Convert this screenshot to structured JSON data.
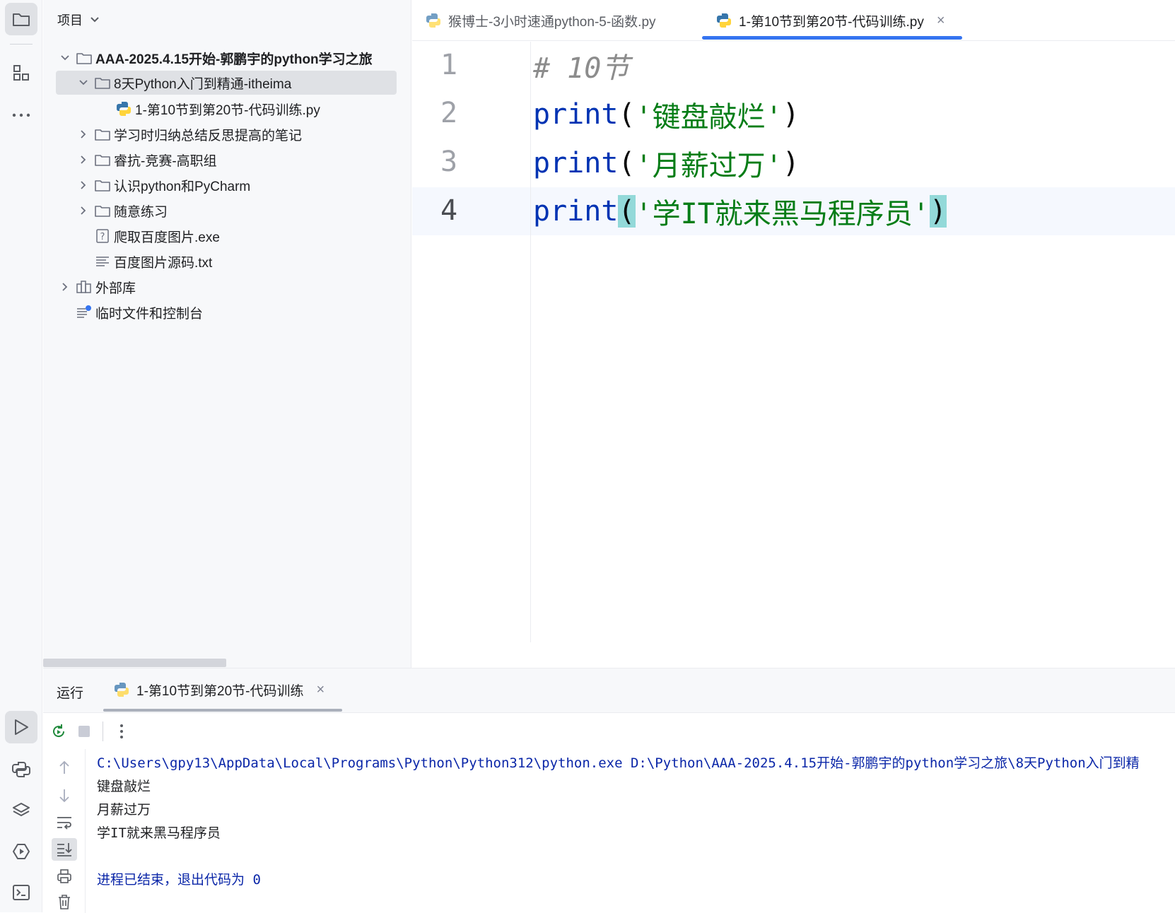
{
  "project_panel": {
    "title": "项目",
    "tree": [
      {
        "label": "AAA-2025.4.15开始-郭鹏宇的python学习之旅",
        "type": "folder",
        "depth": 0,
        "expanded": true,
        "bold": true
      },
      {
        "label": "8天Python入门到精通-itheima",
        "type": "folder",
        "depth": 1,
        "expanded": true,
        "selected": true
      },
      {
        "label": "1-第10节到第20节-代码训练.py",
        "type": "python-file",
        "depth": 2
      },
      {
        "label": "学习时归纳总结反思提高的笔记",
        "type": "folder",
        "depth": 1,
        "expanded": false
      },
      {
        "label": "睿抗-竞赛-高职组",
        "type": "folder",
        "depth": 1,
        "expanded": false
      },
      {
        "label": "认识python和PyCharm",
        "type": "folder",
        "depth": 1,
        "expanded": false
      },
      {
        "label": "随意练习",
        "type": "folder",
        "depth": 1,
        "expanded": false
      },
      {
        "label": "爬取百度图片.exe",
        "type": "unknown-file",
        "depth": 1
      },
      {
        "label": "百度图片源码.txt",
        "type": "text-file",
        "depth": 1
      },
      {
        "label": "外部库",
        "type": "library",
        "depth": 0,
        "expanded": false
      },
      {
        "label": "临时文件和控制台",
        "type": "scratches",
        "depth": 0
      }
    ]
  },
  "editor_tabs": [
    {
      "label": "猴博士-3小时速通python-5-函数.py",
      "active": false
    },
    {
      "label": "1-第10节到第20节-代码训练.py",
      "active": true,
      "close": "×"
    }
  ],
  "editor": {
    "line_numbers": [
      "1",
      "2",
      "3",
      "4"
    ],
    "lines": [
      {
        "comment": "# 10节"
      },
      {
        "func": "print",
        "open": "(",
        "string": "'键盘敲烂'",
        "close": ")"
      },
      {
        "func": "print",
        "open": "(",
        "string": "'月薪过万'",
        "close": ")"
      },
      {
        "func": "print",
        "open": "(",
        "string": "'学IT就来黑马程序员'",
        "close": ")"
      }
    ]
  },
  "run_panel": {
    "title": "运行",
    "tab_label": "1-第10节到第20节-代码训练",
    "tab_close": "×",
    "console": {
      "command": "C:\\Users\\gpy13\\AppData\\Local\\Programs\\Python\\Python312\\python.exe D:\\Python\\AAA-2025.4.15开始-郭鹏宇的python学习之旅\\8天Python入门到精",
      "output": [
        "键盘敲烂",
        "月薪过万",
        "学IT就来黑马程序员"
      ],
      "exit_message": "进程已结束，退出代码为 0"
    }
  },
  "colors": {
    "accent": "#3574f0",
    "keyword": "#0033b3",
    "string": "#067d17",
    "comment": "#8c8c8c",
    "brace_highlight": "#93d9d9",
    "console_system": "#0a26a8",
    "python_blue": "#3776ab",
    "python_yellow": "#ffd43b"
  },
  "icons": {
    "activity_bar": [
      "folder-icon",
      "structure-icon",
      "more-icon",
      "run-icon",
      "python-console-icon",
      "layers-icon",
      "services-icon",
      "terminal-icon"
    ],
    "run_toolbar": [
      "rerun-icon",
      "stop-icon",
      "more-vertical-icon"
    ],
    "run_side": [
      "arrow-up-icon",
      "arrow-down-icon",
      "soft-wrap-icon",
      "scroll-to-end-icon",
      "print-icon",
      "trash-icon"
    ]
  }
}
